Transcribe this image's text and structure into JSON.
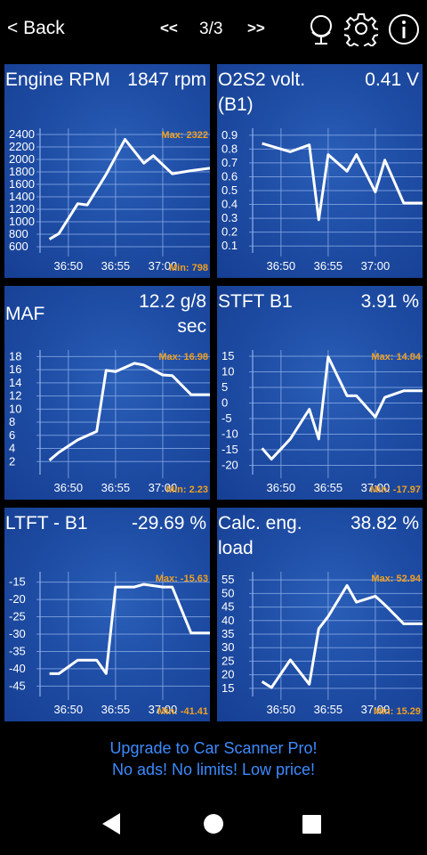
{
  "topbar": {
    "back_label": "< Back",
    "prev_label": "<<",
    "page_indicator": "3/3",
    "next_label": ">>",
    "icons": [
      "globe-stand-icon",
      "gear-icon",
      "info-icon"
    ]
  },
  "tiles": [
    {
      "name": "Engine RPM",
      "value": "1847 rpm",
      "max_label": "Max: 2322",
      "min_label": "Min: 798",
      "y_ticks": [
        "2400",
        "2200",
        "2000",
        "1800",
        "1600",
        "1400",
        "1200",
        "1000",
        "800",
        "600"
      ],
      "x_ticks": [
        "36:50",
        "36:55",
        "37:00"
      ],
      "chart_data": {
        "type": "line",
        "x": [
          "36:48",
          "36:49",
          "36:51",
          "36:52",
          "36:54",
          "36:56",
          "36:58",
          "36:59",
          "37:01",
          "37:03",
          "37:05"
        ],
        "y": [
          720,
          810,
          1290,
          1270,
          1760,
          2322,
          1940,
          2060,
          1770,
          1820,
          1860
        ],
        "ylim": [
          500,
          2500
        ]
      }
    },
    {
      "name": "O2S2 volt. (B1)",
      "value": "0.41 V",
      "max_label": "",
      "min_label": "",
      "y_ticks": [
        "0.9",
        "0.8",
        "0.7",
        "0.6",
        "0.5",
        "0.4",
        "0.3",
        "0.2",
        "0.1"
      ],
      "x_ticks": [
        "36:50",
        "36:55",
        "37:00"
      ],
      "chart_data": {
        "type": "line",
        "x": [
          "36:48",
          "36:49",
          "36:51",
          "36:53",
          "36:54",
          "36:55",
          "36:57",
          "36:58",
          "37:00",
          "37:01",
          "37:03",
          "37:05"
        ],
        "y": [
          0.84,
          0.82,
          0.78,
          0.83,
          0.29,
          0.76,
          0.64,
          0.76,
          0.49,
          0.72,
          0.41,
          0.41
        ],
        "ylim": [
          0.05,
          0.95
        ]
      }
    },
    {
      "name": "MAF",
      "value": "12.2 g/8 sec",
      "max_label": "Max: 16.98",
      "min_label": "Min: 2.23",
      "y_ticks": [
        "18",
        "16",
        "14",
        "12",
        "10",
        "8",
        "6",
        "4",
        "2"
      ],
      "x_ticks": [
        "36:50",
        "36:55",
        "37:00"
      ],
      "chart_data": {
        "type": "line",
        "x": [
          "36:48",
          "36:49",
          "36:51",
          "36:53",
          "36:54",
          "36:55",
          "36:57",
          "36:58",
          "37:00",
          "37:01",
          "37:03",
          "37:05"
        ],
        "y": [
          2.2,
          3.4,
          5.3,
          6.6,
          15.9,
          15.7,
          16.98,
          16.7,
          15.2,
          15.1,
          12.2,
          12.2
        ],
        "ylim": [
          0,
          19
        ]
      }
    },
    {
      "name": "STFT B1",
      "value": "3.91 %",
      "max_label": "Max: 14.84",
      "min_label": "Min: -17.97",
      "y_ticks": [
        "15",
        "10",
        "5",
        "0",
        "-5",
        "-10",
        "-15",
        "-20"
      ],
      "x_ticks": [
        "36:50",
        "36:55",
        "37:00"
      ],
      "chart_data": {
        "type": "line",
        "x": [
          "36:48",
          "36:49",
          "36:51",
          "36:53",
          "36:54",
          "36:55",
          "36:57",
          "36:58",
          "37:00",
          "37:01",
          "37:03",
          "37:05"
        ],
        "y": [
          -14.5,
          -18,
          -11.5,
          -2,
          -11.5,
          14.84,
          2.3,
          2.3,
          -4.5,
          1.8,
          3.91,
          3.91
        ],
        "ylim": [
          -23,
          17
        ]
      }
    },
    {
      "name": "LTFT - B1",
      "value": "-29.69 %",
      "max_label": "Max: -15.63",
      "min_label": "Min: -41.41",
      "y_ticks": [
        "-15",
        "-20",
        "-25",
        "-30",
        "-35",
        "-40",
        "-45"
      ],
      "x_ticks": [
        "36:50",
        "36:55",
        "37:00"
      ],
      "chart_data": {
        "type": "line",
        "x": [
          "36:48",
          "36:49",
          "36:51",
          "36:53",
          "36:54",
          "36:55",
          "36:57",
          "36:58",
          "37:00",
          "37:01",
          "37:03",
          "37:05"
        ],
        "y": [
          -41.41,
          -41.41,
          -37.5,
          -37.5,
          -41.4,
          -16.4,
          -16.4,
          -15.63,
          -16.4,
          -16.4,
          -29.69,
          -29.69
        ],
        "ylim": [
          -48,
          -12
        ]
      }
    },
    {
      "name": "Calc. eng. load",
      "value": "38.82 %",
      "max_label": "Max: 52.94",
      "min_label": "Min: 15.29",
      "y_ticks": [
        "55",
        "50",
        "45",
        "40",
        "35",
        "30",
        "25",
        "20",
        "15"
      ],
      "x_ticks": [
        "36:50",
        "36:55",
        "37:00"
      ],
      "chart_data": {
        "type": "line",
        "x": [
          "36:48",
          "36:49",
          "36:51",
          "36:53",
          "36:54",
          "36:55",
          "36:57",
          "36:58",
          "37:00",
          "37:01",
          "37:03",
          "37:05"
        ],
        "y": [
          17.5,
          15.29,
          25.5,
          16.5,
          37,
          41.5,
          52.94,
          46.8,
          49,
          45.8,
          38.82,
          38.82
        ],
        "ylim": [
          12,
          58
        ]
      }
    }
  ],
  "promo": {
    "line1": "Upgrade to Car Scanner Pro!",
    "line2": "No ads! No limits! Low price!"
  },
  "colors": {
    "background": "#000000",
    "tile": "#1f4ea6",
    "grid": "#8fb0ea",
    "line": "#ffffff",
    "max_min_label": "#f0a020",
    "promo_text": "#3d8bff"
  },
  "system_nav": [
    "back-triangle-icon",
    "home-circle-icon",
    "recents-square-icon"
  ]
}
